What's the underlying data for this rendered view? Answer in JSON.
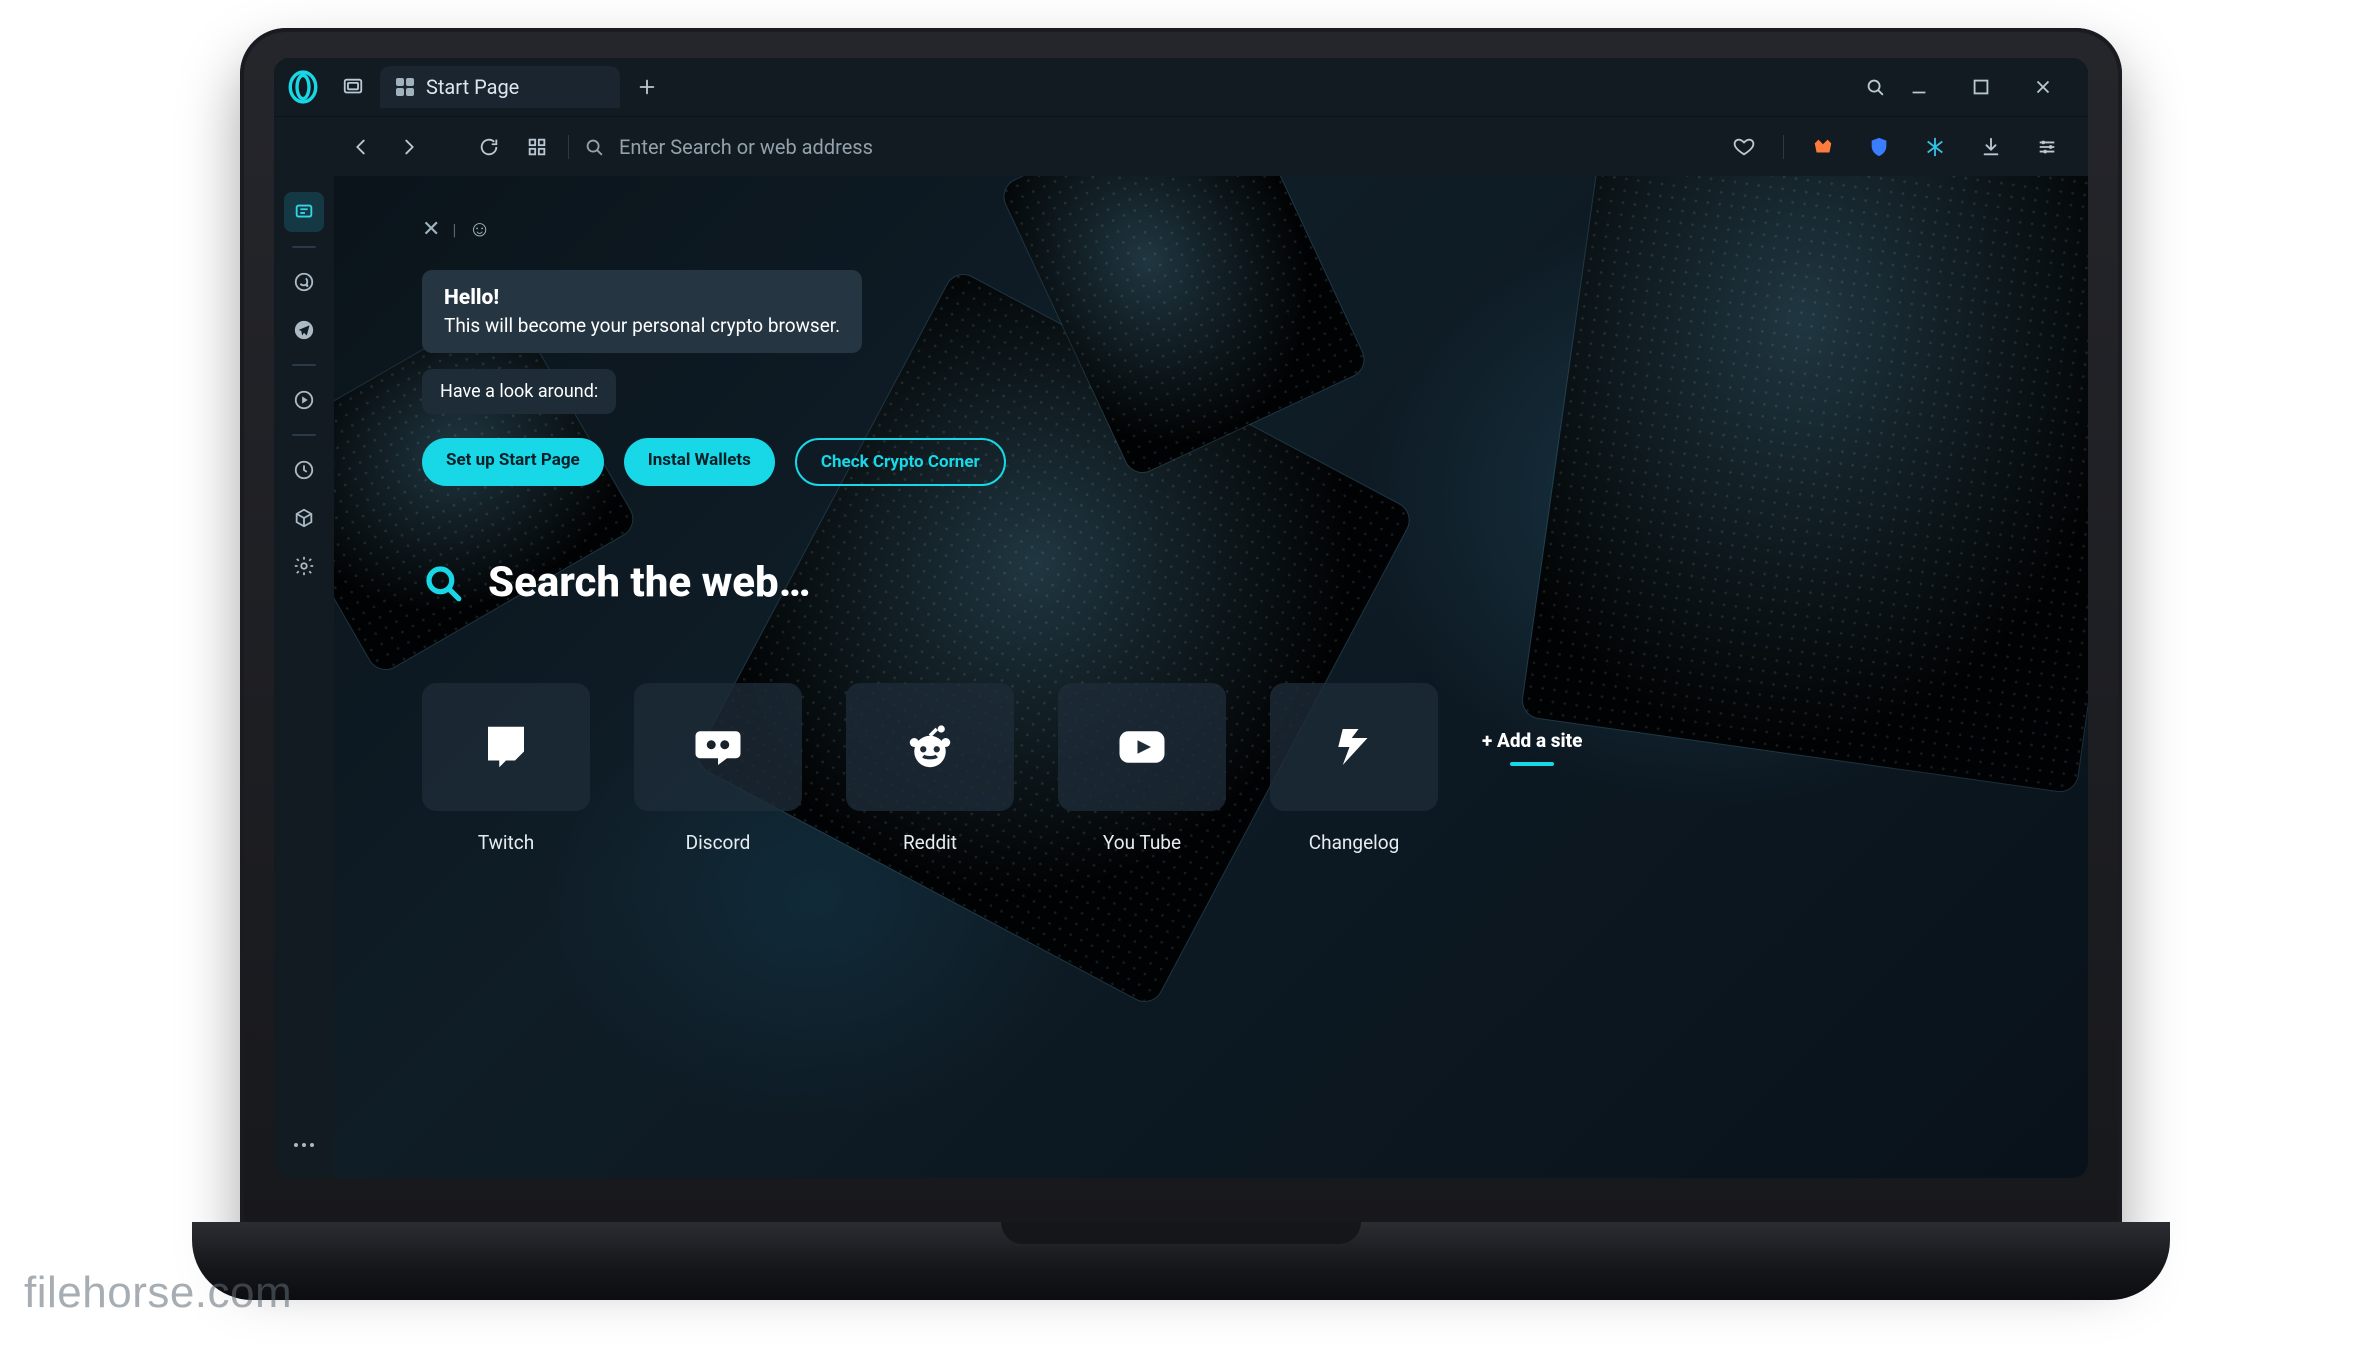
{
  "tab": {
    "title": "Start Page"
  },
  "address_bar": {
    "placeholder": "Enter Search or web address"
  },
  "greeting": {
    "title": "Hello!",
    "subtitle": "This will become your personal crypto browser.",
    "hint": "Have a look around:"
  },
  "cta": {
    "setup": "Set up Start Page",
    "wallets": "Instal Wallets",
    "corner": "Check Crypto Corner"
  },
  "search_heading": "Search the web…",
  "speed_dials": [
    {
      "label": "Twitch",
      "icon": "twitch-icon"
    },
    {
      "label": "Discord",
      "icon": "discord-icon"
    },
    {
      "label": "Reddit",
      "icon": "reddit-icon"
    },
    {
      "label": "You Tube",
      "icon": "youtube-icon"
    },
    {
      "label": "Changelog",
      "icon": "changelog-icon"
    }
  ],
  "add_site_label": "+ Add a site",
  "watermark": "filehorse.com",
  "colors": {
    "accent": "#18d7e6"
  }
}
